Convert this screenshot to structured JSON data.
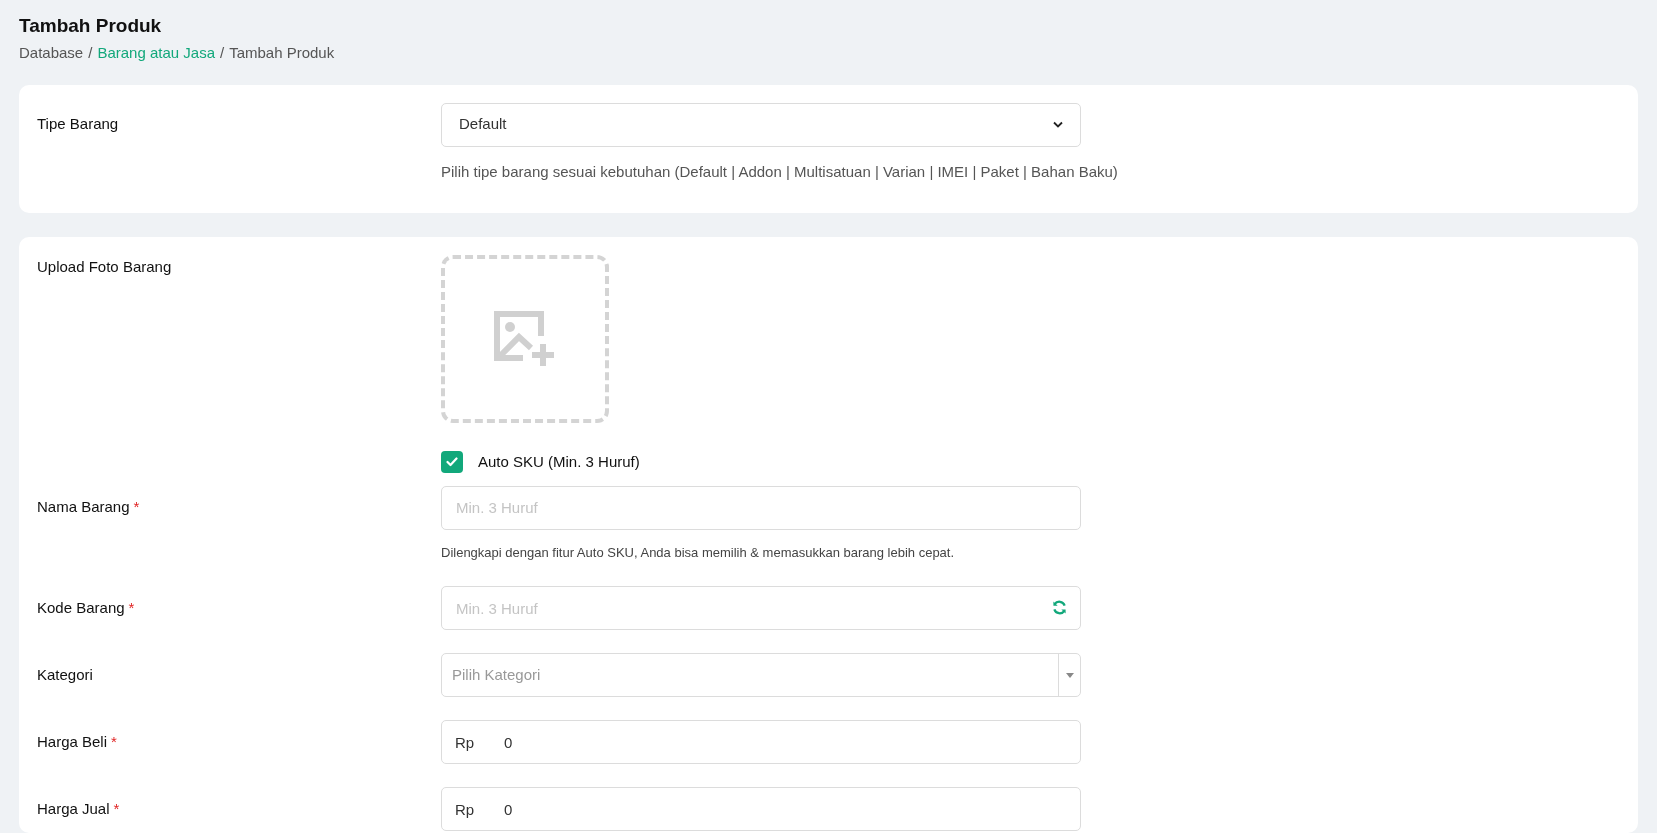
{
  "page": {
    "title": "Tambah Produk",
    "separator": "/",
    "breadcrumb": [
      {
        "label": "Database",
        "link": false
      },
      {
        "label": "Barang atau Jasa",
        "link": true
      },
      {
        "label": "Tambah Produk",
        "link": false
      }
    ]
  },
  "cards": [
    {
      "fields": [
        {
          "kind": "select",
          "label": "Tipe Barang",
          "value": "Default",
          "help": "Pilih tipe barang sesuai kebutuhan (Default | Addon | Multisatuan | Varian | IMEI | Paket | Bahan Baku)"
        }
      ]
    },
    {
      "fields": [
        {
          "kind": "upload",
          "label": "Upload Foto Barang"
        },
        {
          "kind": "text",
          "label": "Nama Barang",
          "required_mark": "*",
          "checkbox": {
            "label": "Auto SKU (Min. 3 Huruf)",
            "checked": true
          },
          "placeholder": "Min. 3 Huruf",
          "help": "Dilengkapi dengan fitur Auto SKU, Anda bisa memilih & memasukkan barang lebih cepat."
        },
        {
          "kind": "refresh",
          "label": "Kode Barang",
          "required_mark": "*",
          "placeholder": "Min. 3 Huruf"
        },
        {
          "kind": "combobox",
          "label": "Kategori",
          "placeholder": "Pilih Kategori"
        },
        {
          "kind": "currency",
          "label": "Harga Beli",
          "required_mark": "*",
          "prefix": "Rp",
          "value": "0"
        },
        {
          "kind": "currency",
          "label": "Harga Jual",
          "required_mark": "*",
          "prefix": "Rp",
          "value": "0"
        }
      ]
    }
  ]
}
